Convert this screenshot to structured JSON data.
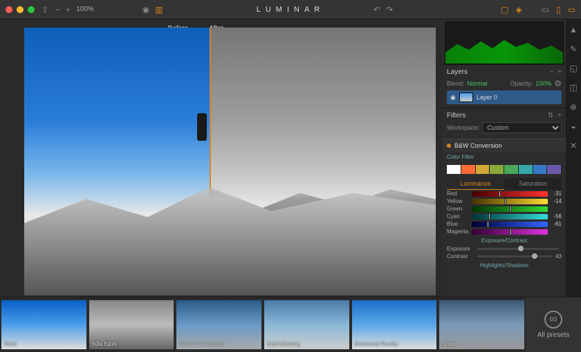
{
  "app": {
    "title": "LUMINAR",
    "zoom": "100%"
  },
  "compare": {
    "before": "Before",
    "after": "After"
  },
  "histogram": {
    "icon": "histogram"
  },
  "layers": {
    "heading": "Layers",
    "blend_label": "Blend:",
    "blend_value": "Normal",
    "opacity_label": "Opacity:",
    "opacity_value": "100%",
    "layer0": "Layer 0"
  },
  "filters": {
    "heading": "Filters",
    "workspace_label": "Workspace:",
    "workspace_value": "Custom",
    "bw_conversion": "B&W Conversion",
    "color_filter": "Color Filter",
    "swatches": [
      "#ffffff",
      "#ff6b35",
      "#d4a837",
      "#8aa837",
      "#4aa85a",
      "#37a8a8",
      "#3778c8",
      "#6a5aa8"
    ],
    "tabs": {
      "luminance": "Luminance",
      "saturation": "Saturation"
    },
    "channels": [
      {
        "name": "Red",
        "value": "-31",
        "knob": 35
      },
      {
        "name": "Yellow",
        "value": "-14",
        "knob": 43
      },
      {
        "name": "Green",
        "value": "",
        "knob": 50
      },
      {
        "name": "Cyan",
        "value": "-56",
        "knob": 22
      },
      {
        "name": "Blue",
        "value": "-61",
        "knob": 20
      },
      {
        "name": "Magenta",
        "value": "",
        "knob": 50
      }
    ],
    "exposure_section": "Exposure/Contrast",
    "exposure": {
      "label": "Exposure",
      "value": "",
      "knob": 50
    },
    "contrast": {
      "label": "Contrast",
      "value": "43",
      "knob": 72
    },
    "highlights_section": "Highlights/Shadows"
  },
  "presets": [
    {
      "name": "Vivid",
      "cls": "p-vivid"
    },
    {
      "name": "60ta B&W",
      "cls": "p-bw"
    },
    {
      "name": "Center of Attention",
      "cls": "p-center"
    },
    {
      "name": "Cold Morning",
      "cls": "p-cold"
    },
    {
      "name": "Enhanced Reality",
      "cls": "p-enh"
    },
    {
      "name": "Noble",
      "cls": "p-noble"
    }
  ],
  "all_presets": "All presets"
}
